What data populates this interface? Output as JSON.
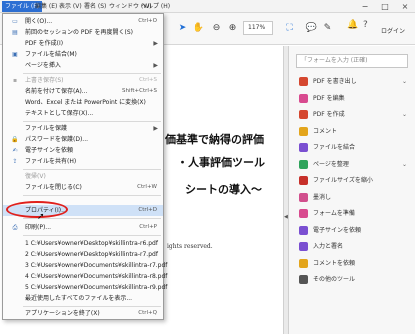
{
  "menubar": {
    "items": [
      "ファイル (F)",
      "編集 (E)",
      "表示 (V)",
      "署名 (S)",
      "ウィンドウ (W)",
      "ヘルプ (H)"
    ],
    "window_controls": [
      "−",
      "□",
      "×"
    ]
  },
  "toolbar": {
    "zoom": "117%",
    "login": "ログイン"
  },
  "document": {
    "line1": "価基準で納得の評価",
    "line2": "・人事評価ツール",
    "line3": "シートの導入～",
    "line4": "ights reserved."
  },
  "right_panel": {
    "search_placeholder": "「フォームを入力 (正確)",
    "tools": [
      {
        "label": "PDF を書き出し",
        "color": "#d5472f",
        "chevron": true
      },
      {
        "label": "PDF を編集",
        "color": "#d84a8f",
        "chevron": false
      },
      {
        "label": "PDF を作成",
        "color": "#d5472f",
        "chevron": true
      },
      {
        "label": "コメント",
        "color": "#e3a51c",
        "chevron": false
      },
      {
        "label": "ファイルを結合",
        "color": "#7a4fd1",
        "chevron": false
      },
      {
        "label": "ページを整理",
        "color": "#2fa35b",
        "chevron": true
      },
      {
        "label": "ファイルサイズを縮小",
        "color": "#c7302a",
        "chevron": false
      },
      {
        "label": "墨消し",
        "color": "#d14f8d",
        "chevron": false
      },
      {
        "label": "フォームを準備",
        "color": "#d84a8f",
        "chevron": false
      },
      {
        "label": "電子サインを依頼",
        "color": "#7a4fd1",
        "chevron": false
      },
      {
        "label": "入力と署名",
        "color": "#7a4fd1",
        "chevron": false
      },
      {
        "label": "コメントを依頼",
        "color": "#e3a51c",
        "chevron": false
      },
      {
        "label": "その他のツール",
        "color": "#555555",
        "chevron": false
      }
    ]
  },
  "file_menu": {
    "open": {
      "label": "開く(O)...",
      "shortcut": "Ctrl+O"
    },
    "reopen": {
      "label": "前回のセッションの PDF を再度開く(S)",
      "shortcut": ""
    },
    "create_pdf": {
      "label": "PDF を作成(I)",
      "shortcut": ""
    },
    "combine": {
      "label": "ファイルを結合(M)",
      "shortcut": ""
    },
    "insert_pages": {
      "label": "ページを挿入",
      "shortcut": ""
    },
    "save": {
      "label": "上書き保存(S)",
      "shortcut": "Ctrl+S"
    },
    "save_as": {
      "label": "名前を付けて保存(A)...",
      "shortcut": "Shift+Ctrl+S"
    },
    "save_as_office": {
      "label": "Word、Excel または PowerPoint に変換(X)",
      "shortcut": ""
    },
    "save_as_text": {
      "label": "テキストとして保存(X)...",
      "shortcut": ""
    },
    "protect": {
      "label": "ファイルを保護",
      "shortcut": ""
    },
    "password_protect": {
      "label": "パスワードを保護(D)...",
      "shortcut": ""
    },
    "request_sign": {
      "label": "電子サインを依頼",
      "shortcut": ""
    },
    "share": {
      "label": "ファイルを共有(H)",
      "shortcut": ""
    },
    "revert": {
      "label": "復帰(V)",
      "shortcut": ""
    },
    "close": {
      "label": "ファイルを閉じる(C)",
      "shortcut": "Ctrl+W"
    },
    "properties": {
      "label": "プロパティ(I)...",
      "shortcut": "Ctrl+D"
    },
    "print": {
      "label": "印刷(P)...",
      "shortcut": "Ctrl+P"
    },
    "recent": [
      "1 C:¥Users¥owner¥Desktop¥skillintra-r6.pdf",
      "2 C:¥Users¥owner¥Desktop¥skillintra-r7.pdf",
      "3 C:¥Users¥owner¥Documents¥skillintra-r7.pdf",
      "4 C:¥Users¥owner¥Documents¥skillintra-r8.pdf",
      "5 C:¥Users¥owner¥Documents¥skillintra-r9.pdf"
    ],
    "show_recent": {
      "label": "最近使用したすべてのファイルを表示...",
      "shortcut": ""
    },
    "exit": {
      "label": "アプリケーションを終了(X)",
      "shortcut": "Ctrl+Q"
    }
  }
}
